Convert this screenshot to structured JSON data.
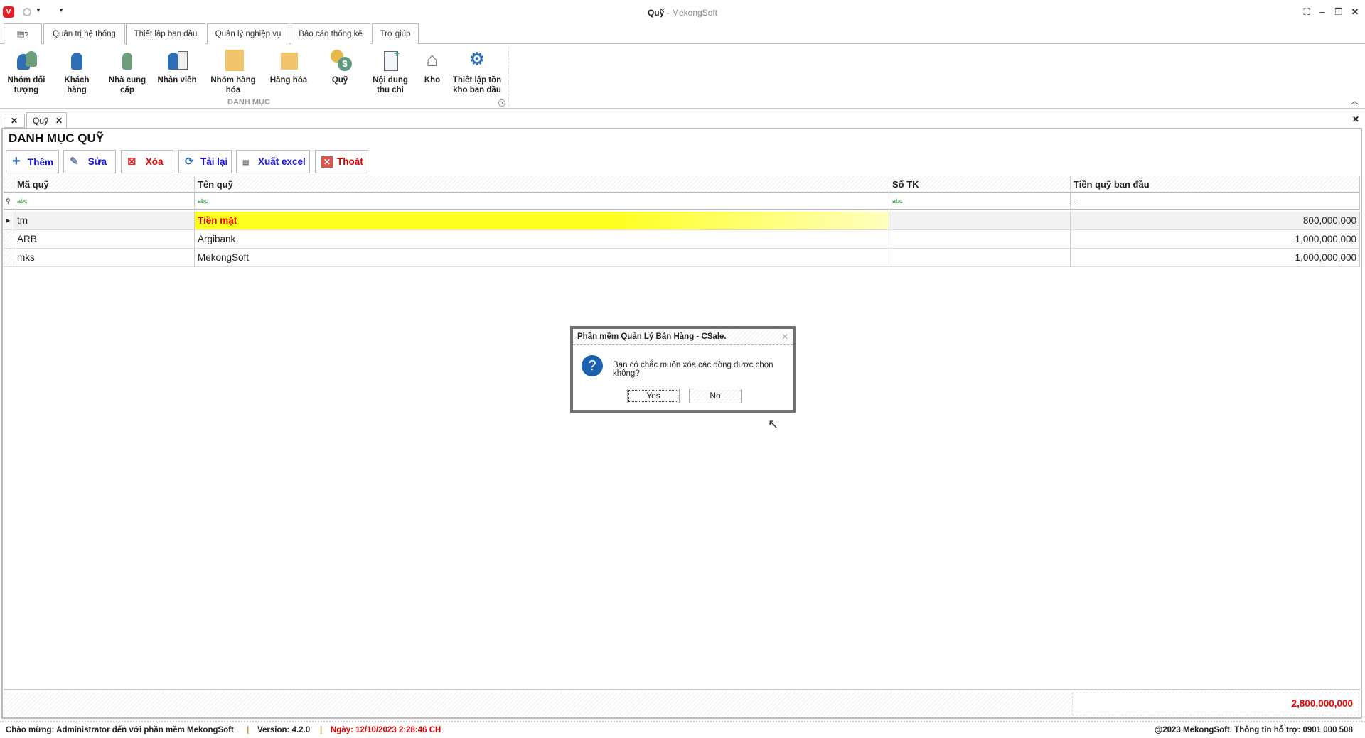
{
  "window": {
    "title": "Quỹ",
    "title_suffix": "- MekongSoft"
  },
  "ribbon_tabs": [
    {
      "label": "Quản trị hệ thống"
    },
    {
      "label": "Thiết lập ban đầu",
      "active": true
    },
    {
      "label": "Quản lý nghiệp vụ"
    },
    {
      "label": "Báo cáo thống kê"
    },
    {
      "label": "Trợ giúp"
    }
  ],
  "ribbon": {
    "group_label": "DANH MỤC",
    "buttons": [
      {
        "l1": "Nhóm đối",
        "l2": "tượng"
      },
      {
        "l1": "Khách",
        "l2": "hàng"
      },
      {
        "l1": "Nhà cung",
        "l2": "cấp"
      },
      {
        "l1": "Nhân viên",
        "l2": ""
      },
      {
        "l1": "Nhóm hàng",
        "l2": "hóa"
      },
      {
        "l1": "Hàng hóa",
        "l2": ""
      },
      {
        "l1": "Quỹ",
        "l2": ""
      },
      {
        "l1": "Nội dung",
        "l2": "thu chi"
      },
      {
        "l1": "Kho",
        "l2": ""
      },
      {
        "l1": "Thiết lập tồn",
        "l2": "kho ban đầu"
      }
    ]
  },
  "doc_tabs": [
    {
      "label": "Quỹ"
    }
  ],
  "page": {
    "heading": "DANH MỤC QUỸ"
  },
  "toolbar": {
    "add": "Thêm",
    "edit": "Sửa",
    "delete": "Xóa",
    "reload": "Tải lại",
    "export": "Xuất excel",
    "exit": "Thoát"
  },
  "grid": {
    "columns": [
      "Mã quỹ",
      "Tên quỹ",
      "Số TK",
      "Tiền quỹ ban đầu"
    ],
    "filter_icons": [
      "abc",
      "abc",
      "abc",
      "="
    ],
    "rows": [
      {
        "code": "tm",
        "name": "Tiền mặt",
        "account": "",
        "amount": "800,000,000",
        "selected": true
      },
      {
        "code": "ARB",
        "name": "Argibank",
        "account": "",
        "amount": "1,000,000,000"
      },
      {
        "code": "mks",
        "name": "MekongSoft",
        "account": "",
        "amount": "1,000,000,000"
      }
    ],
    "total": "2,800,000,000"
  },
  "dialog": {
    "title": "Phần mềm Quản Lý Bán Hàng - CSale.",
    "message": "Bạn có chắc muốn xóa các dòng được chọn không?",
    "yes": "Yes",
    "no": "No"
  },
  "status": {
    "welcome": "Chào mừng: Administrator đến với phần mềm MekongSoft",
    "version": "Version: 4.2.0",
    "date": "Ngày: 12/10/2023 2:28:46 CH",
    "copyright": "@2023 MekongSoft. Thông tin hỗ trợ: 0901 000 508"
  },
  "colors": {
    "accent_blue": "#1515d8",
    "danger_red": "#e00000",
    "selected_fill": "#ffff20"
  }
}
